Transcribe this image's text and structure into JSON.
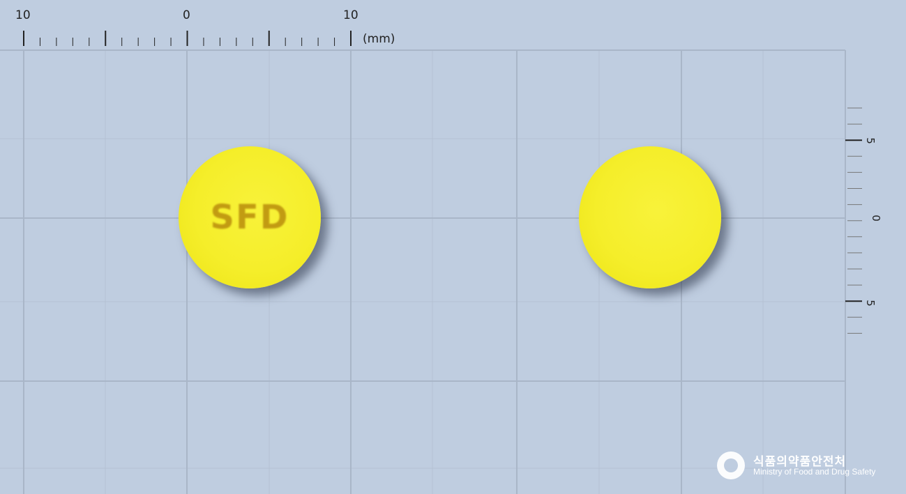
{
  "ruler_top": {
    "labels": [
      "10",
      "0",
      "10"
    ],
    "unit": "(mm)"
  },
  "ruler_right": {
    "labels": [
      "5",
      "0",
      "5"
    ]
  },
  "pills": [
    {
      "name": "front",
      "imprint": "SFD",
      "color": "#f5ee2a"
    },
    {
      "name": "back",
      "imprint": "",
      "color": "#f5ee2a"
    }
  ],
  "logo": {
    "korean": "식품의약품안전처",
    "english": "Ministry of Food and Drug Safety"
  },
  "colors": {
    "background": "#bfcde0",
    "grid": "#a9b6c8",
    "pill": "#f5ee2a",
    "imprint": "#c29b12"
  }
}
